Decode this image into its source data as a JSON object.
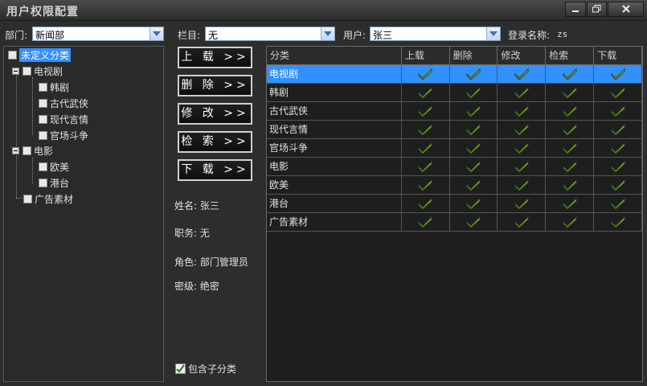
{
  "window": {
    "title": "用户权限配置",
    "controls": [
      "minimize-icon",
      "restore-icon",
      "close-icon"
    ]
  },
  "filters": {
    "dept_label": "部门:",
    "dept_value": "新闻部",
    "column_label": "栏目:",
    "column_value": "无",
    "user_label": "用户:",
    "user_value": "张三",
    "login_label": "登录名称:",
    "login_value": "zs"
  },
  "tree": {
    "root": "未定义分类",
    "groups": [
      {
        "label": "电视剧",
        "children": [
          "韩剧",
          "古代武侠",
          "现代言情",
          "官场斗争"
        ]
      },
      {
        "label": "电影",
        "children": [
          "欧美",
          "港台"
        ]
      },
      {
        "label": "广告素材",
        "children": []
      }
    ]
  },
  "actions": {
    "upload": "上 载 >>",
    "delete": "删 除 >>",
    "modify": "修 改 >>",
    "search": "检 索 >>",
    "download": "下 载 >>"
  },
  "info": {
    "name": "姓名: 张三",
    "position": "职务: 无",
    "role": "角色: 部门管理员",
    "secret": "密级: 绝密"
  },
  "include_sub": {
    "label": "包含子分类",
    "checked": true
  },
  "grid": {
    "headers": [
      "分类",
      "上载",
      "删除",
      "修改",
      "检索",
      "下载"
    ],
    "rows": [
      {
        "name": "电视剧",
        "perms": [
          true,
          true,
          true,
          true,
          true
        ]
      },
      {
        "name": "韩剧",
        "perms": [
          true,
          true,
          true,
          true,
          true
        ]
      },
      {
        "name": "古代武侠",
        "perms": [
          true,
          true,
          true,
          true,
          true
        ]
      },
      {
        "name": "现代言情",
        "perms": [
          true,
          true,
          true,
          true,
          true
        ]
      },
      {
        "name": "官场斗争",
        "perms": [
          true,
          true,
          true,
          true,
          true
        ]
      },
      {
        "name": "电影",
        "perms": [
          true,
          true,
          true,
          true,
          true
        ]
      },
      {
        "name": "欧美",
        "perms": [
          true,
          true,
          true,
          true,
          true
        ]
      },
      {
        "name": "港台",
        "perms": [
          true,
          true,
          true,
          true,
          true
        ]
      },
      {
        "name": "广告素材",
        "perms": [
          true,
          true,
          true,
          true,
          true
        ]
      }
    ],
    "selected_row": 0
  },
  "colors": {
    "selection": "#3390ff",
    "check": "#8ccc3c"
  }
}
